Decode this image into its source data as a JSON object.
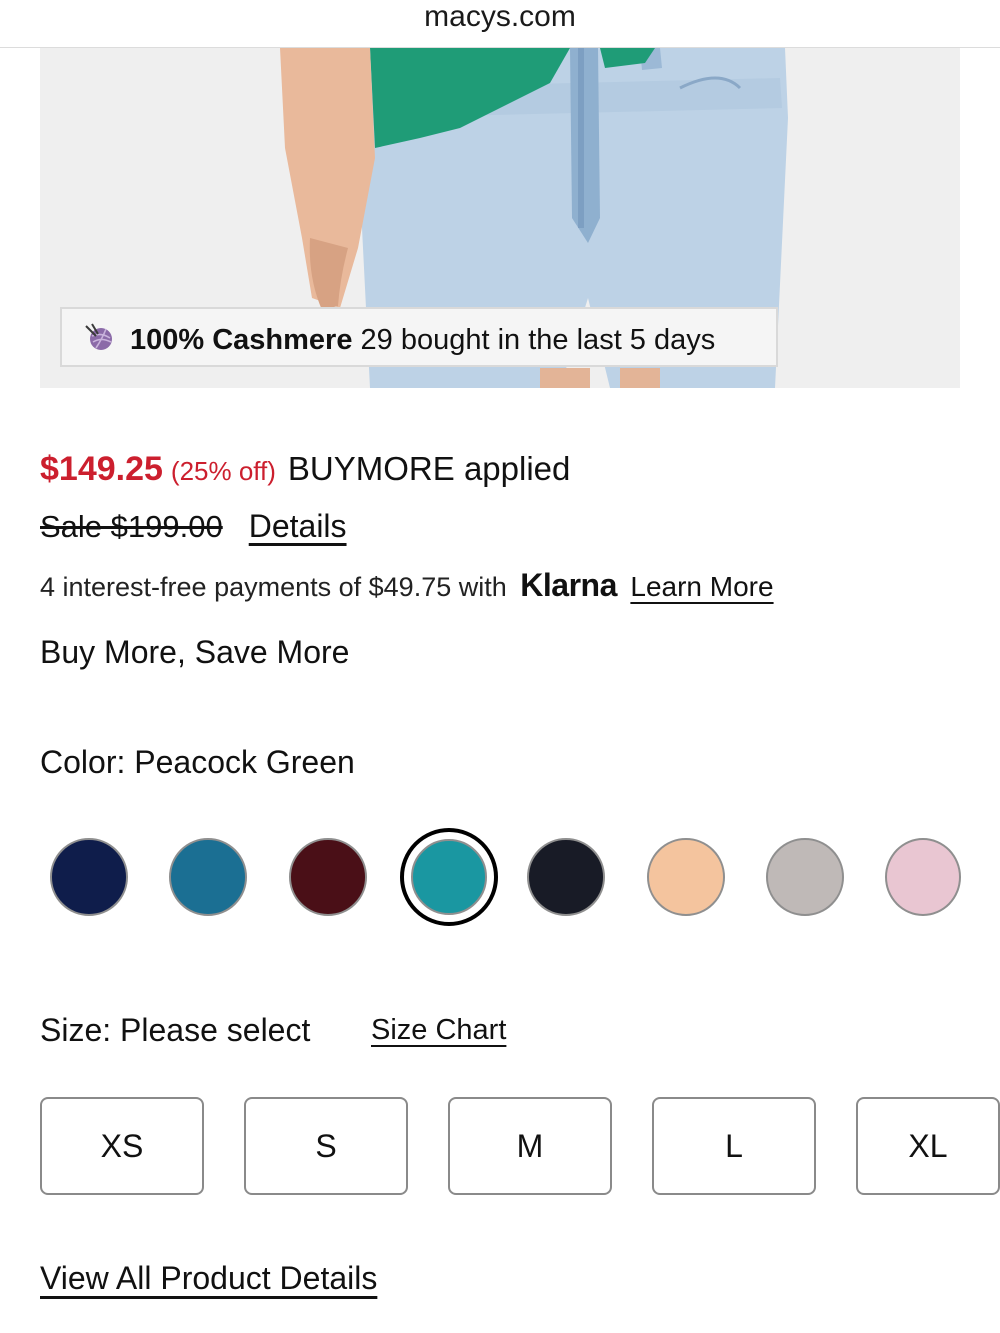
{
  "browser": {
    "url": "macys.com"
  },
  "product_image": {
    "badge": {
      "icon": "yarn-ball-icon",
      "bold_text": "100% Cashmere",
      "text": "29 bought in the last 5 days"
    }
  },
  "pricing": {
    "sale_price": "$149.25",
    "discount": "(25% off)",
    "promo_applied": "BUYMORE applied",
    "original_price": "Sale $199.00",
    "details_link": "Details",
    "klarna_text": "4 interest-free payments of $49.75 with",
    "klarna_logo": "Klarna",
    "klarna_learn_more": "Learn More",
    "promo_message": "Buy More, Save More",
    "accent_color": "#cc1f2e"
  },
  "color": {
    "label": "Color: Peacock Green",
    "selected": "Peacock Green",
    "swatches": [
      {
        "color": "#0f1d4b"
      },
      {
        "color": "#1b6f93"
      },
      {
        "color": "#4a0f17"
      },
      {
        "color": "#1a97a1",
        "selected": true
      },
      {
        "color": "#181b26"
      },
      {
        "color": "#f4c49e"
      },
      {
        "color": "#bfb9b7"
      },
      {
        "color": "#e9c6d2"
      }
    ]
  },
  "size": {
    "label": "Size: Please select",
    "chart_link": "Size Chart",
    "options": [
      "XS",
      "S",
      "M",
      "L",
      "XL"
    ]
  },
  "view_all_details": "View All Product Details"
}
